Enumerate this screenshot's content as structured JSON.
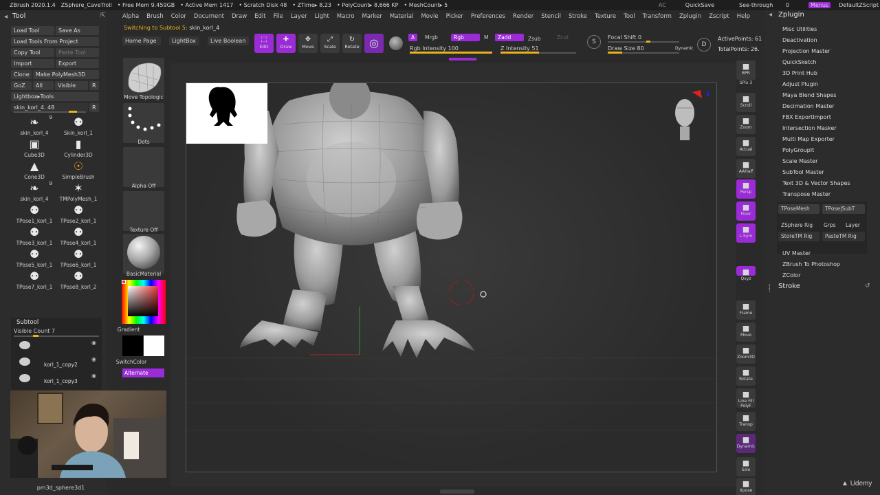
{
  "titlebar": {
    "app": "ZBrush 2020.1.4",
    "project": "ZSphere_CaveTroll",
    "free_mem": "• Free Mem 9.459GB",
    "active_mem": "• Active Mem 1417",
    "scratch": "• Scratch Disk 48",
    "ztime": "• ZTime▸ 8.23",
    "polycount": "• PolyCount▸ 8.666 KP",
    "meshcount": "• MeshCount▸ 5",
    "ac": "AC",
    "quicksave": "QuickSave",
    "seethrough": "See-through",
    "seethrough_val": "0",
    "menus": "Menus",
    "script": "DefaultZScript"
  },
  "menubar": [
    "Alpha",
    "Brush",
    "Color",
    "Document",
    "Draw",
    "Edit",
    "File",
    "Layer",
    "Light",
    "Macro",
    "Marker",
    "Material",
    "Movie",
    "Picker",
    "Preferences",
    "Render",
    "Stencil",
    "Stroke",
    "Texture",
    "Tool",
    "Transform",
    "Zplugin",
    "Zscript",
    "Help"
  ],
  "notification": "Switching to Subtool 5:",
  "notification_target": "skin_korl_4",
  "tool": {
    "title": "Tool",
    "load_tool": "Load Tool",
    "save_as": "Save As",
    "load_from_project": "Load Tools From Project",
    "copy_tool": "Copy Tool",
    "paste_tool": "Paste Tool",
    "import": "Import",
    "export": "Export",
    "clone": "Clone",
    "make_polymesh": "Make PolyMesh3D",
    "goz": "GoZ",
    "all": "All",
    "visible": "Visible",
    "r": "R",
    "lightbox_tools": "Lightbox▸Tools",
    "current_tool": "skin_korl_4. 48",
    "current_tool_r": "R",
    "thumbs": [
      {
        "label": "skin_korl_4",
        "icon": "leg-mesh-icon",
        "badge": "9"
      },
      {
        "label": "Skin_korl_1",
        "icon": "figure-icon",
        "badge": ""
      },
      {
        "label": "Cube3D",
        "icon": "cube-icon",
        "badge": ""
      },
      {
        "label": "Cylinder3D",
        "icon": "cylinder-icon",
        "badge": ""
      },
      {
        "label": "Cone3D",
        "icon": "cone-icon",
        "badge": ""
      },
      {
        "label": "SimpleBrush",
        "icon": "simplebrush-icon",
        "badge": ""
      },
      {
        "label": "skin_korl_4",
        "icon": "leg-mesh-icon",
        "badge": "9"
      },
      {
        "label": "TMPolyMesh_1",
        "icon": "star-icon",
        "badge": ""
      },
      {
        "label": "TPose1_korl_1",
        "icon": "figure-icon",
        "badge": ""
      },
      {
        "label": "TPose2_korl_1",
        "icon": "figure-icon",
        "badge": ""
      },
      {
        "label": "TPose3_korl_1",
        "icon": "figure-icon",
        "badge": ""
      },
      {
        "label": "TPose4_korl_1",
        "icon": "figure-icon",
        "badge": ""
      },
      {
        "label": "TPose5_korl_1",
        "icon": "figure-icon",
        "badge": ""
      },
      {
        "label": "TPose6_korl_1",
        "icon": "figure-icon",
        "badge": ""
      },
      {
        "label": "TPose7_korl_1",
        "icon": "figure-icon",
        "badge": ""
      },
      {
        "label": "TPose8_korl_2",
        "icon": "figure-icon",
        "badge": ""
      }
    ]
  },
  "subtool": {
    "title": "Subtool",
    "visible_count": "Visible Count 7",
    "items": [
      {
        "name": ""
      },
      {
        "name": "korl_1_copy2"
      },
      {
        "name": "korl_1_copy3"
      }
    ]
  },
  "webcam_caption": "pm3d_sphere3d1",
  "brushes": {
    "move_topologic": "Move Topologic",
    "dots": "Dots",
    "alpha_off": "Alpha Off",
    "texture_off": "Texture Off",
    "basic_material": "BasicMaterial",
    "gradient": "Gradient",
    "switch_color": "SwitchColor",
    "alternate": "Alternate"
  },
  "shelf": {
    "home_page": "Home Page",
    "lightbox": "LightBox",
    "live_boolean": "Live Boolean",
    "edit": "Edit",
    "draw": "Draw",
    "move": "Move",
    "scale": "Scale",
    "rotate": "Rotate",
    "a": "A",
    "mrgb": "Mrgb",
    "rgb": "Rgb",
    "m": "M",
    "zadd": "Zadd",
    "zsub": "Zsub",
    "zcut": "Zcut",
    "rgb_intensity": "Rgb Intensity 100",
    "z_intensity": "Z Intensity 51",
    "focal_shift": "Focal Shift 0",
    "draw_size": "Draw Size 80",
    "dynamic": "Dynamic",
    "active_points": "ActivePoints: 61",
    "total_points": "TotalPoints: 26.",
    "rgb_intensity_level": 1.0,
    "z_intensity_level": 0.51,
    "draw_size_level": 0.2
  },
  "right_strip": [
    {
      "label": "BPR",
      "icon": "bpr-icon"
    },
    {
      "label": "SPix 3",
      "icon": ""
    },
    {
      "label": "Scroll",
      "icon": "hand-icon"
    },
    {
      "label": "Zoom",
      "icon": "zoom-icon"
    },
    {
      "label": "Actual",
      "icon": "actual-icon"
    },
    {
      "label": "AAHalf",
      "icon": "aahalf-icon"
    },
    {
      "label": "Persp",
      "icon": "persp-icon"
    },
    {
      "label": "Floor",
      "icon": "floor-icon"
    },
    {
      "label": "L.Sym",
      "icon": "lsym-icon"
    },
    {
      "label": "Qxyz",
      "icon": "qxyz-icon"
    },
    {
      "label": "Frame",
      "icon": "frame-icon"
    },
    {
      "label": "Move",
      "icon": "move-icon"
    },
    {
      "label": "Zoom3D",
      "icon": "zoom3d-icon"
    },
    {
      "label": "Rotate",
      "icon": "rotate-icon"
    },
    {
      "label": "Line Fill PolyF",
      "icon": "polyf-icon"
    },
    {
      "label": "Transp",
      "icon": "transp-icon"
    },
    {
      "label": "Dynamic",
      "icon": "ghost-icon"
    },
    {
      "label": "Solo",
      "icon": "solo-icon"
    },
    {
      "label": "Xpose",
      "icon": "xpose-icon"
    }
  ],
  "zplugin": {
    "title": "Zplugin",
    "items": [
      "Misc Utilities",
      "Deactivation",
      "Projection Master",
      "QuickSketch",
      "3D Print Hub",
      "Adjust Plugin",
      "Maya Blend Shapes",
      "Decimation Master",
      "FBX ExportImport",
      "Intersection Masker",
      "Multi Map Exporter",
      "PolyGroupIt",
      "Scale Master",
      "SubTool Master",
      "Text 3D & Vector Shapes",
      "Transpose Master"
    ],
    "tpose_mesh": "TPoseMesh",
    "tpose_subt": "TPose|SubT",
    "zsphere_rig": "ZSphere Rig",
    "grps": "Grps",
    "layer": "Layer",
    "store_tm_rig": "StoreTM Rig",
    "paste_tm_rig": "PasteTM Rig",
    "uv_master": "UV Master",
    "zbrush_to_ps": "ZBrush To Photoshop",
    "zcolor": "ZColor",
    "stroke": "Stroke"
  },
  "watermark": "Udemy",
  "colors": {
    "accent": "#9a2bd6",
    "slider": "#e8b21a",
    "bg": "#2a2a2a"
  }
}
